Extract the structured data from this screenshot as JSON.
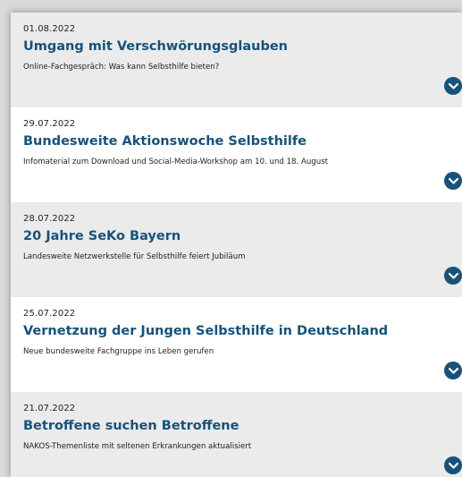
{
  "news": [
    {
      "date": "01.08.2022",
      "title": "Umgang mit Verschwörungsglauben",
      "teaser": "Online-Fachgespräch: Was kann Selbsthilfe bieten?"
    },
    {
      "date": "29.07.2022",
      "title": "Bundesweite Aktionswoche Selbsthilfe",
      "teaser": "Infomaterial zum Download und Social-Media-Workshop am 10. und 18. August"
    },
    {
      "date": "28.07.2022",
      "title": "20 Jahre SeKo Bayern",
      "teaser": "Landesweite Netzwerkstelle für Selbsthilfe feiert Jubiläum"
    },
    {
      "date": "25.07.2022",
      "title": "Vernetzung der Jungen Selbsthilfe in Deutschland",
      "teaser": "Neue bundesweite Fachgruppe ins Leben gerufen"
    },
    {
      "date": "21.07.2022",
      "title": "Betroffene suchen Betroffene",
      "teaser": "NAKOS-Themenliste mit seltenen Erkrankungen aktualisiert"
    }
  ],
  "icons": {
    "expand": "chevron-down-icon"
  },
  "colors": {
    "accent": "#17527a",
    "shaded_row": "#ebebeb",
    "plain_row": "#ffffff"
  }
}
